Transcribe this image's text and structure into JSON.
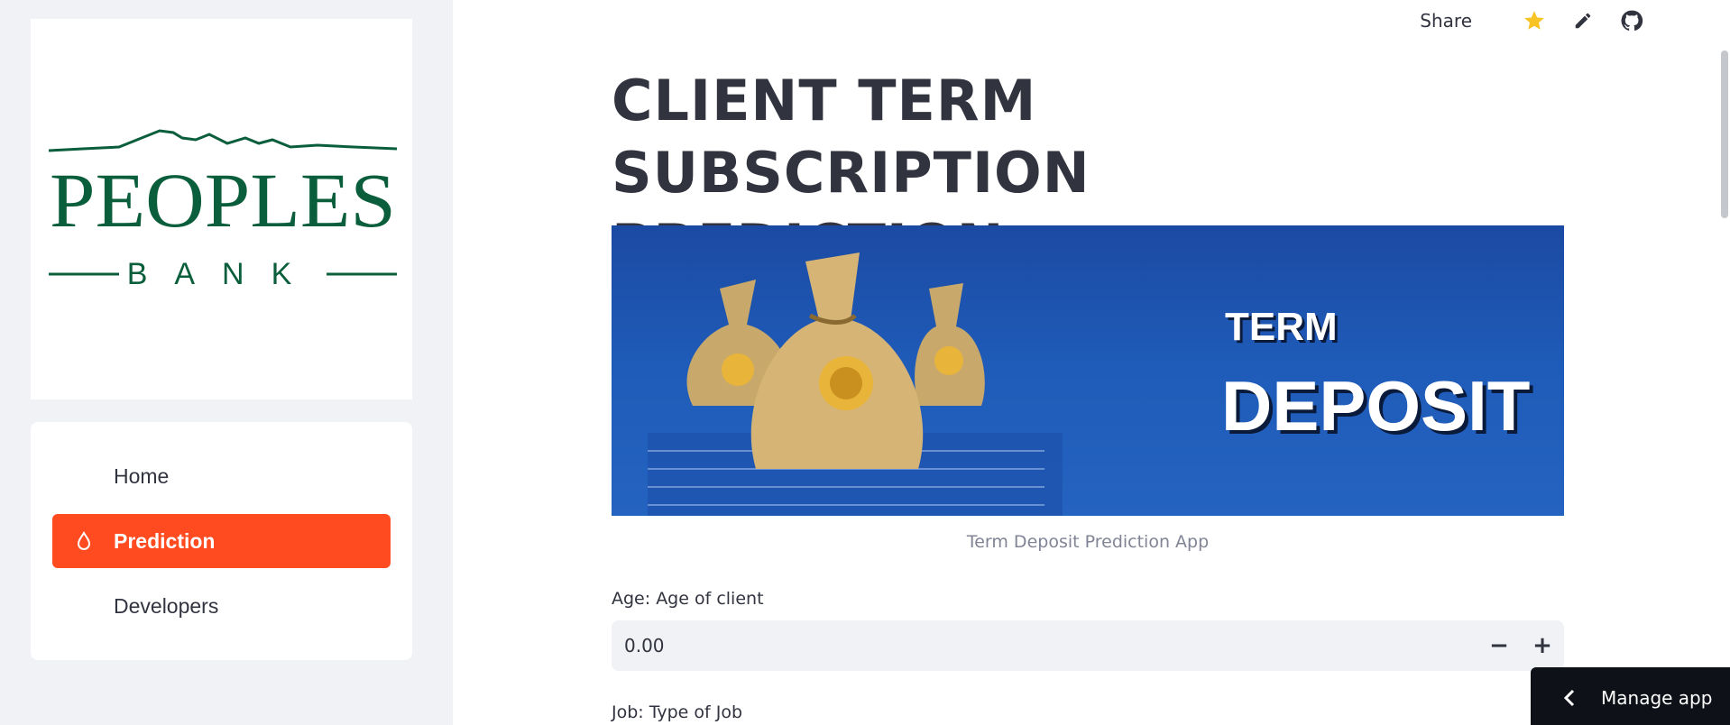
{
  "sidebar": {
    "logo": {
      "name": "PEOPLES",
      "sub": "BANK",
      "color": "#0b5e3b"
    },
    "items": [
      {
        "label": "Home"
      },
      {
        "label": "Prediction",
        "active": true
      },
      {
        "label": "Developers"
      }
    ]
  },
  "header": {
    "share_label": "Share",
    "icons": [
      "star-icon",
      "edit-pencil-icon",
      "github-icon"
    ]
  },
  "main": {
    "title": "CLIENT TERM SUBSCRIPTION PREDICTION",
    "banner": {
      "word1": "TERM",
      "word2": "DEPOSIT"
    },
    "caption": "Term Deposit Prediction App",
    "fields": [
      {
        "label": "Age: Age of client",
        "value": "0.00"
      },
      {
        "label": "Job: Type of Job"
      }
    ]
  },
  "manage_app": {
    "label": "Manage app"
  },
  "colors": {
    "accent": "#ff4b1f",
    "sidebar_bg": "#f0f2f6",
    "text": "#31333f",
    "star": "#f7c325"
  }
}
